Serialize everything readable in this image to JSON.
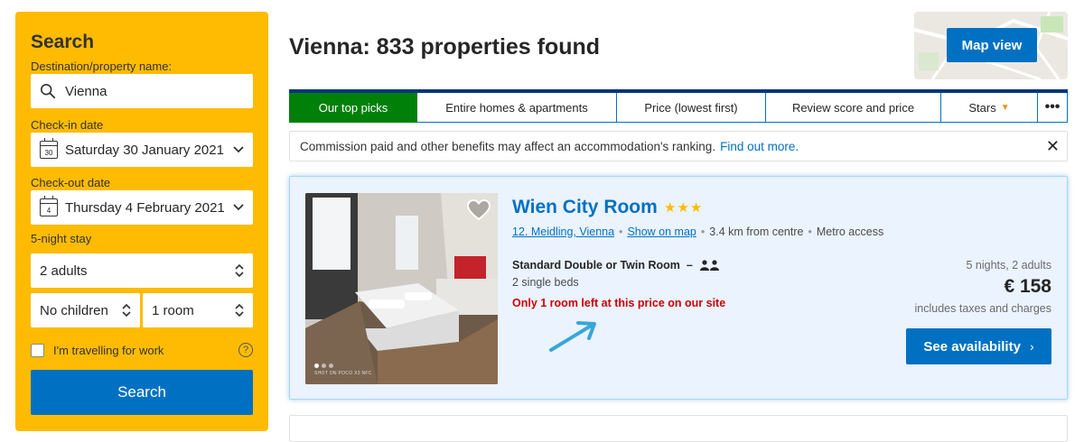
{
  "sidebar": {
    "title": "Search",
    "destination_label": "Destination/property name:",
    "destination_value": "Vienna",
    "checkin_label": "Check-in date",
    "checkin_value": "Saturday 30 January 2021",
    "checkin_icon_day": "30",
    "checkout_label": "Check-out date",
    "checkout_value": "Thursday 4 February 2021",
    "checkout_icon_day": "4",
    "stay_label": "5-night stay",
    "adults_value": "2 adults",
    "children_value": "No children",
    "rooms_value": "1 room",
    "work_checkbox_label": "I'm travelling for work",
    "work_checkbox_checked": false,
    "help_icon_glyph": "?",
    "search_button": "Search"
  },
  "header": {
    "title": "Vienna: 833 properties found",
    "map_button": "Map view"
  },
  "sort_tabs": [
    {
      "label": "Our top picks",
      "active": true
    },
    {
      "label": "Entire homes & apartments",
      "active": false
    },
    {
      "label": "Price (lowest first)",
      "active": false
    },
    {
      "label": "Review score and price",
      "active": false
    },
    {
      "label": "Stars",
      "active": false
    },
    {
      "label": "•••",
      "active": false
    }
  ],
  "notice": {
    "text": "Commission paid and other benefits may affect an accommodation's ranking.",
    "link": "Find out more.",
    "close_glyph": "✕"
  },
  "property": {
    "name": "Wien City Room",
    "stars": "★★★",
    "district_link": "12. Meidling, Vienna",
    "map_link": "Show on map",
    "distance": "3.4 km from centre",
    "transport": "Metro access",
    "separator": "•",
    "room_name": "Standard Double or Twin Room",
    "room_dash": "–",
    "beds": "2 single beds",
    "scarcity": "Only 1 room left at this price on our site",
    "stay_summary": "5 nights, 2 adults",
    "price": "€ 158",
    "taxes_note": "includes taxes and charges",
    "availability_button": "See availability",
    "availability_chevron": "›",
    "photo_caption": "SHOT ON POCO X3 NFC"
  },
  "colors": {
    "sidebar_bg": "#febb02",
    "brand_blue": "#0071c2",
    "active_tab": "#008009",
    "scarcity_red": "#cc0000",
    "card_bg": "#ebf3ff",
    "star_yellow": "#febb02"
  },
  "icons": {
    "search": "search-icon",
    "calendar": "calendar-icon",
    "chevron": "chevron-down-icon",
    "updown": "up-down-arrows-icon",
    "heart": "heart-icon",
    "people": "two-people-icon",
    "close": "close-icon"
  }
}
